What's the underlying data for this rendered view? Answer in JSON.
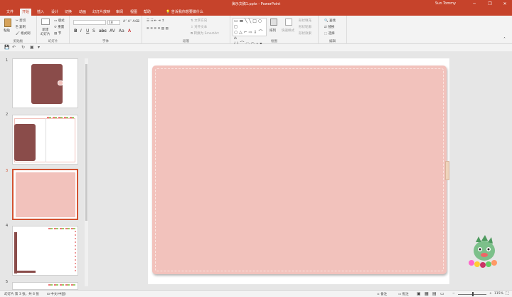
{
  "window": {
    "title": "演示文稿1.pptx  -  PowerPoint",
    "user": "Sun Tommy",
    "controls": [
      "─",
      "❐",
      "✕"
    ]
  },
  "ribbon_tabs": [
    "文件",
    "开始",
    "插入",
    "设计",
    "切换",
    "动画",
    "幻灯片放映",
    "审阅",
    "视图",
    "帮助"
  ],
  "active_tab": "开始",
  "tell_me": "告诉我你想要做什么",
  "groups": {
    "clipboard": {
      "label": "剪贴板",
      "paste": "粘贴",
      "cut": "剪切",
      "copy": "复制",
      "format_painter": "格式刷"
    },
    "slides": {
      "label": "幻灯片",
      "new_slide": "新建\n幻灯片",
      "layout": "版式",
      "reset": "重置",
      "section": "节"
    },
    "font": {
      "label": "字体",
      "size": "18"
    },
    "paragraph": {
      "label": "段落",
      "text_direction": "文字方向",
      "align_text": "对齐文本",
      "smartart": "转换为 SmartArt"
    },
    "drawing": {
      "label": "绘图",
      "arrange": "排列",
      "quick_styles": "快速样式",
      "fill": "形状填充",
      "outline": "形状轮廓",
      "effects": "形状效果"
    },
    "editing": {
      "label": "编辑",
      "find": "查找",
      "replace": "替换",
      "select": "选择"
    }
  },
  "slide_numbers": [
    "1",
    "2",
    "3",
    "4",
    "5"
  ],
  "active_slide": "3",
  "status": {
    "slide_info": "幻灯片 第 3 张，共 6 张",
    "language": "中文(中国)",
    "notes": "备注",
    "comments": "批注",
    "zoom": "115%"
  },
  "colors": {
    "accent": "#c6432b",
    "paper_fill": "#f2c2bc",
    "cover_dark": "#8a4c4a"
  }
}
